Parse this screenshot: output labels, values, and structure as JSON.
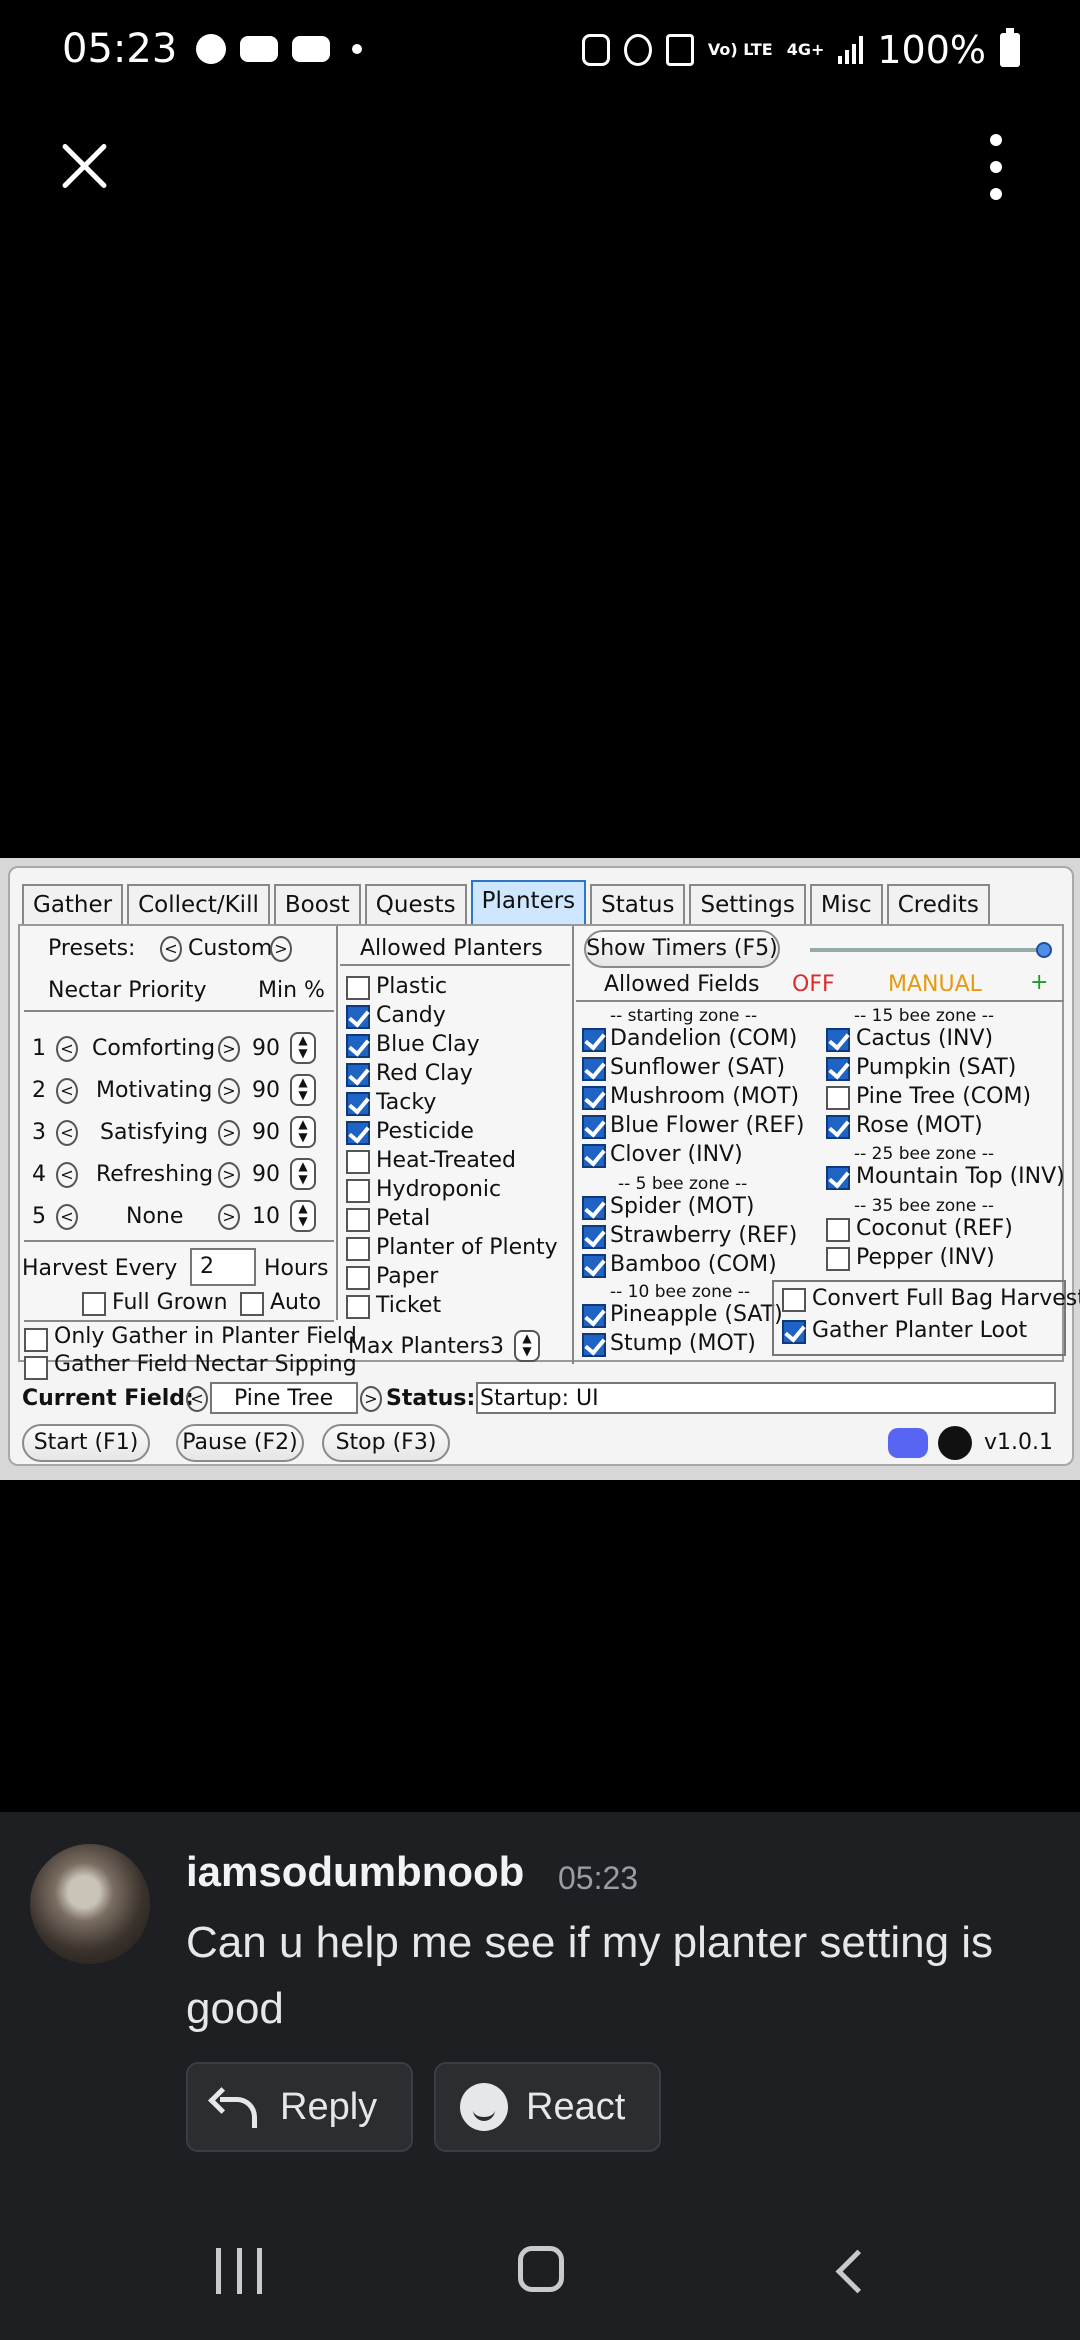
{
  "status_bar": {
    "time": "05:23",
    "battery": "100%",
    "volte": "Vo) LTE",
    "network": "4G+"
  },
  "planters_ui": {
    "tabs": [
      "Gather",
      "Collect/Kill",
      "Boost",
      "Quests",
      "Planters",
      "Status",
      "Settings",
      "Misc",
      "Credits"
    ],
    "active_tab": "Planters",
    "presets_label": "Presets:",
    "preset_value": "Custom",
    "nectar_priority_label": "Nectar Priority",
    "min_pct_label": "Min %",
    "nectars": [
      {
        "index": "1",
        "name": "Comforting",
        "min": "90"
      },
      {
        "index": "2",
        "name": "Motivating",
        "min": "90"
      },
      {
        "index": "3",
        "name": "Satisfying",
        "min": "90"
      },
      {
        "index": "4",
        "name": "Refreshing",
        "min": "90"
      },
      {
        "index": "5",
        "name": "None",
        "min": "10"
      }
    ],
    "harvest_every_label": "Harvest Every",
    "harvest_every_value": "2",
    "hours_label": "Hours",
    "full_grown_label": "Full Grown",
    "auto_label": "Auto",
    "only_gather_label": "Only Gather in Planter Field",
    "gather_nectar_label": "Gather Field Nectar Sipping",
    "allowed_planters_label": "Allowed Planters",
    "planters": [
      {
        "name": "Plastic",
        "checked": false
      },
      {
        "name": "Candy",
        "checked": true
      },
      {
        "name": "Blue Clay",
        "checked": true
      },
      {
        "name": "Red Clay",
        "checked": true
      },
      {
        "name": "Tacky",
        "checked": true
      },
      {
        "name": "Pesticide",
        "checked": true
      },
      {
        "name": "Heat-Treated",
        "checked": false
      },
      {
        "name": "Hydroponic",
        "checked": false
      },
      {
        "name": "Petal",
        "checked": false
      },
      {
        "name": "Planter of Plenty",
        "checked": false
      },
      {
        "name": "Paper",
        "checked": false
      },
      {
        "name": "Ticket",
        "checked": false
      }
    ],
    "max_planters_label": "Max Planters",
    "max_planters_value": "3",
    "show_timers_label": "Show Timers (F5)",
    "allowed_fields_label": "Allowed Fields",
    "off_label": "OFF",
    "manual_label": "MANUAL",
    "plus_label": "+",
    "zones": {
      "starting": "-- starting zone --",
      "five": "-- 5 bee zone --",
      "ten": "-- 10 bee zone --",
      "fifteen": "-- 15 bee zone --",
      "twentyfive": "-- 25 bee zone --",
      "thirtyfive": "-- 35 bee zone --"
    },
    "fields_left": [
      {
        "name": "Dandelion (COM)",
        "checked": true
      },
      {
        "name": "Sunflower (SAT)",
        "checked": true
      },
      {
        "name": "Mushroom (MOT)",
        "checked": true
      },
      {
        "name": "Blue Flower (REF)",
        "checked": true
      },
      {
        "name": "Clover (INV)",
        "checked": true
      },
      {
        "name": "Spider (MOT)",
        "checked": true
      },
      {
        "name": "Strawberry (REF)",
        "checked": true
      },
      {
        "name": "Bamboo (COM)",
        "checked": true
      },
      {
        "name": "Pineapple (SAT)",
        "checked": true
      },
      {
        "name": "Stump (MOT)",
        "checked": true
      }
    ],
    "fields_right": [
      {
        "name": "Cactus (INV)",
        "checked": true
      },
      {
        "name": "Pumpkin (SAT)",
        "checked": true
      },
      {
        "name": "Pine Tree (COM)",
        "checked": false
      },
      {
        "name": "Rose (MOT)",
        "checked": true
      },
      {
        "name": "Mountain Top (INV)",
        "checked": true
      },
      {
        "name": "Coconut (REF)",
        "checked": false
      },
      {
        "name": "Pepper (INV)",
        "checked": false
      }
    ],
    "convert_full_bag_label": "Convert Full Bag Harvest",
    "gather_planter_loot_label": "Gather Planter Loot",
    "current_field_label": "Current Field:",
    "current_field_value": "Pine Tree",
    "status_label": "Status:",
    "status_value": "Startup: UI",
    "start_label": "Start (F1)",
    "pause_label": "Pause (F2)",
    "stop_label": "Stop (F3)",
    "version": "v1.0.1"
  },
  "message": {
    "username": "iamsodumbnoob",
    "timestamp": "05:23",
    "text": "Can u help me see if my planter setting is good",
    "reply_label": "Reply",
    "react_label": "React"
  }
}
